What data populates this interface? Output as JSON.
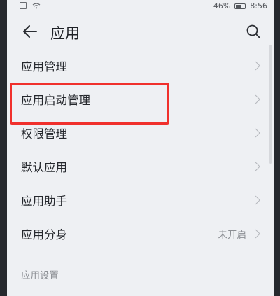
{
  "status_bar": {
    "battery_text": "46%",
    "time": "8:56"
  },
  "app_bar": {
    "title": "应用",
    "back_icon": "back-arrow-icon",
    "search_icon": "search-icon"
  },
  "menu": {
    "items": [
      {
        "label": "应用管理",
        "value": ""
      },
      {
        "label": "应用启动管理",
        "value": ""
      },
      {
        "label": "权限管理",
        "value": ""
      },
      {
        "label": "默认应用",
        "value": ""
      },
      {
        "label": "应用助手",
        "value": ""
      },
      {
        "label": "应用分身",
        "value": "未开启"
      }
    ]
  },
  "section": {
    "header": "应用设置"
  },
  "colors": {
    "highlight": "#f0302c",
    "background": "#eef0f3"
  }
}
